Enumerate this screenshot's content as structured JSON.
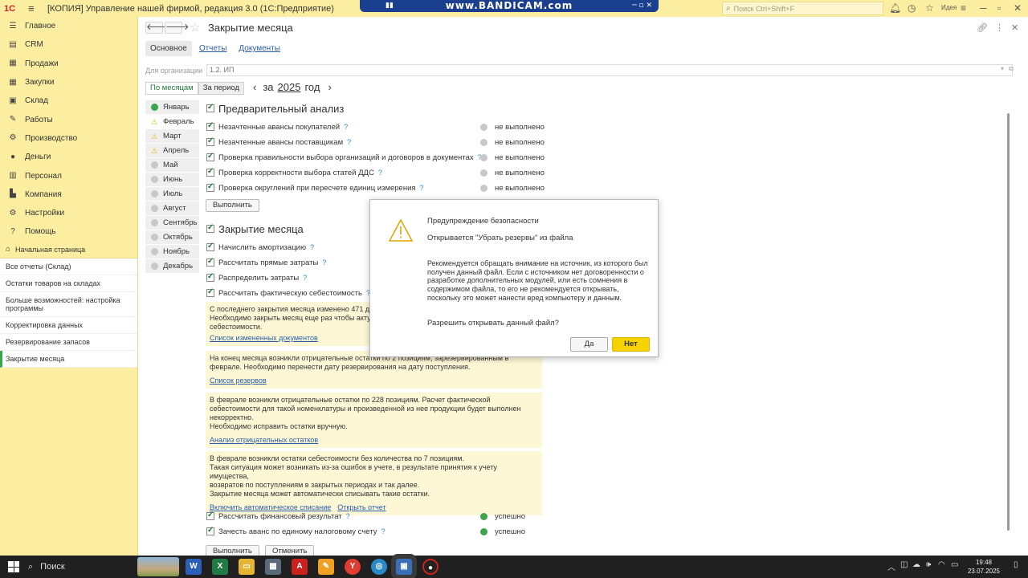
{
  "titlebar": {
    "app_title": "[КОПИЯ] Управление нашей фирмой, редакция 3.0  (1С:Предприятие)",
    "logo": "1С",
    "recorder_watermark": "www.BANDICAM.com",
    "search_placeholder": "Поиск Ctrl+Shift+F",
    "ideas_label": "Идея"
  },
  "sidebar": {
    "items": [
      {
        "label": "Главное",
        "icon": "menu-icon"
      },
      {
        "label": "CRM",
        "icon": "crm-icon"
      },
      {
        "label": "Продажи",
        "icon": "sales-icon"
      },
      {
        "label": "Закупки",
        "icon": "purchases-icon"
      },
      {
        "label": "Склад",
        "icon": "warehouse-icon"
      },
      {
        "label": "Работы",
        "icon": "works-icon"
      },
      {
        "label": "Производство",
        "icon": "production-icon"
      },
      {
        "label": "Деньги",
        "icon": "money-icon"
      },
      {
        "label": "Персонал",
        "icon": "staff-icon"
      },
      {
        "label": "Компания",
        "icon": "company-icon"
      },
      {
        "label": "Настройки",
        "icon": "gear-icon"
      },
      {
        "label": "Помощь",
        "icon": "help-icon"
      }
    ],
    "open_windows": [
      "Начальная страница",
      "Все отчеты (Склад)",
      "Остатки товаров на складах",
      "Больше возможностей: настройка программы",
      "Корректировка данных",
      "Резервирование запасов",
      "Закрытие месяца"
    ]
  },
  "header": {
    "title": "Закрытие месяца",
    "tabs": [
      "Основное",
      "Отчеты",
      "Документы"
    ]
  },
  "org": {
    "label": "Для организации",
    "value": "1.2. ИП"
  },
  "period": {
    "tabs": [
      "По месяцам",
      "За период"
    ],
    "prefix": "за",
    "year": "2025",
    "suffix": "год"
  },
  "months": [
    {
      "name": "Январь",
      "status": "done"
    },
    {
      "name": "Февраль",
      "status": "warning"
    },
    {
      "name": "Март",
      "status": "warning"
    },
    {
      "name": "Апрель",
      "status": "warning"
    },
    {
      "name": "Май",
      "status": "none"
    },
    {
      "name": "Июнь",
      "status": "none"
    },
    {
      "name": "Июль",
      "status": "none"
    },
    {
      "name": "Август",
      "status": "none"
    },
    {
      "name": "Сентябрь",
      "status": "none"
    },
    {
      "name": "Октябрь",
      "status": "none"
    },
    {
      "name": "Ноябрь",
      "status": "none"
    },
    {
      "name": "Декабрь",
      "status": "none"
    }
  ],
  "preliminary": {
    "title": "Предварительный анализ",
    "items": [
      {
        "label": "Незачтенные авансы покупателей",
        "status": "не выполнено"
      },
      {
        "label": "Незачтенные авансы поставщикам",
        "status": "не выполнено"
      },
      {
        "label": "Проверка правильности выбора организаций и договоров в документах",
        "status": "не выполнено"
      },
      {
        "label": "Проверка корректности выбора статей ДДС",
        "status": "не выполнено"
      },
      {
        "label": "Проверка округлений при пересчете единиц измерения",
        "status": "не выполнено"
      }
    ],
    "run_button": "Выполнить"
  },
  "closing": {
    "title": "Закрытие месяца",
    "items": [
      {
        "label": "Начислить амортизацию"
      },
      {
        "label": "Рассчитать прямые затраты"
      },
      {
        "label": "Распределить затраты"
      },
      {
        "label": "Рассчитать фактическую себестоимость"
      }
    ],
    "notes": [
      {
        "text": [
          "С последнего закрытия месяца изменено 471 д",
          "Необходимо закрыть месяц еще раз чтобы акту",
          "себестоимости."
        ],
        "links": [
          "Список измененных документов"
        ]
      },
      {
        "text": [
          "На конец месяца возникли отрицательные остатки по 2 позициям, зарезервированным в",
          "феврале. Необходимо перенести дату резервирования на дату поступления."
        ],
        "links": [
          "Список резервов"
        ]
      },
      {
        "text": [
          "В феврале возникли отрицательные остатки по 228 позициям. Расчет фактической",
          "себестоимости для такой номенклатуры и произведенной из нее продукции будет выполнен",
          "некорректно.",
          "Необходимо исправить остатки вручную."
        ],
        "links": [
          "Анализ отрицательных остатков"
        ]
      },
      {
        "text": [
          "В феврале возникли остатки себестоимости без количества по 7 позициям.",
          "Такая ситуация может возникать из-за ошибок в учете, в результате принятия к учету имущества,",
          "возвратов по поступлениям в закрытых периодах и так далее.",
          "Закрытие месяца может автоматически списывать такие остатки."
        ],
        "links": [
          "Включить автоматическое списание",
          "Открыть отчет"
        ]
      }
    ],
    "final_items": [
      {
        "label": "Рассчитать финансовый результат",
        "status": "успешно"
      },
      {
        "label": "Зачесть аванс по единому налоговому счету",
        "status": "успешно"
      }
    ],
    "partial_buttons": [
      "Выполнить",
      "Отменить"
    ]
  },
  "dialog": {
    "title": "Предупреждение безопасности",
    "file_line": "Открывается \"Убрать резервы\" из файла",
    "body": "Рекомендуется обращать внимание на источник, из которого был получен данный файл. Если с источником нет договоренности о разработке дополнительных модулей, или есть сомнения в содержимом файла, то его не рекомендуется открывать, поскольку это может нанести вред компьютеру и данным.",
    "question": "Разрешить открывать данный файл?",
    "yes": "Да",
    "no": "Нет"
  },
  "taskbar": {
    "search_label": "Поиск",
    "time": "19:48",
    "date": "23.07.2025"
  },
  "colors": {
    "panel_yellow": "#fbeea0",
    "accent_green": "#3aa54a",
    "link_blue": "#2a5ea8",
    "note_bg": "#fdf7d6",
    "default_button": "#f5d200",
    "warning": "#e2b300"
  }
}
